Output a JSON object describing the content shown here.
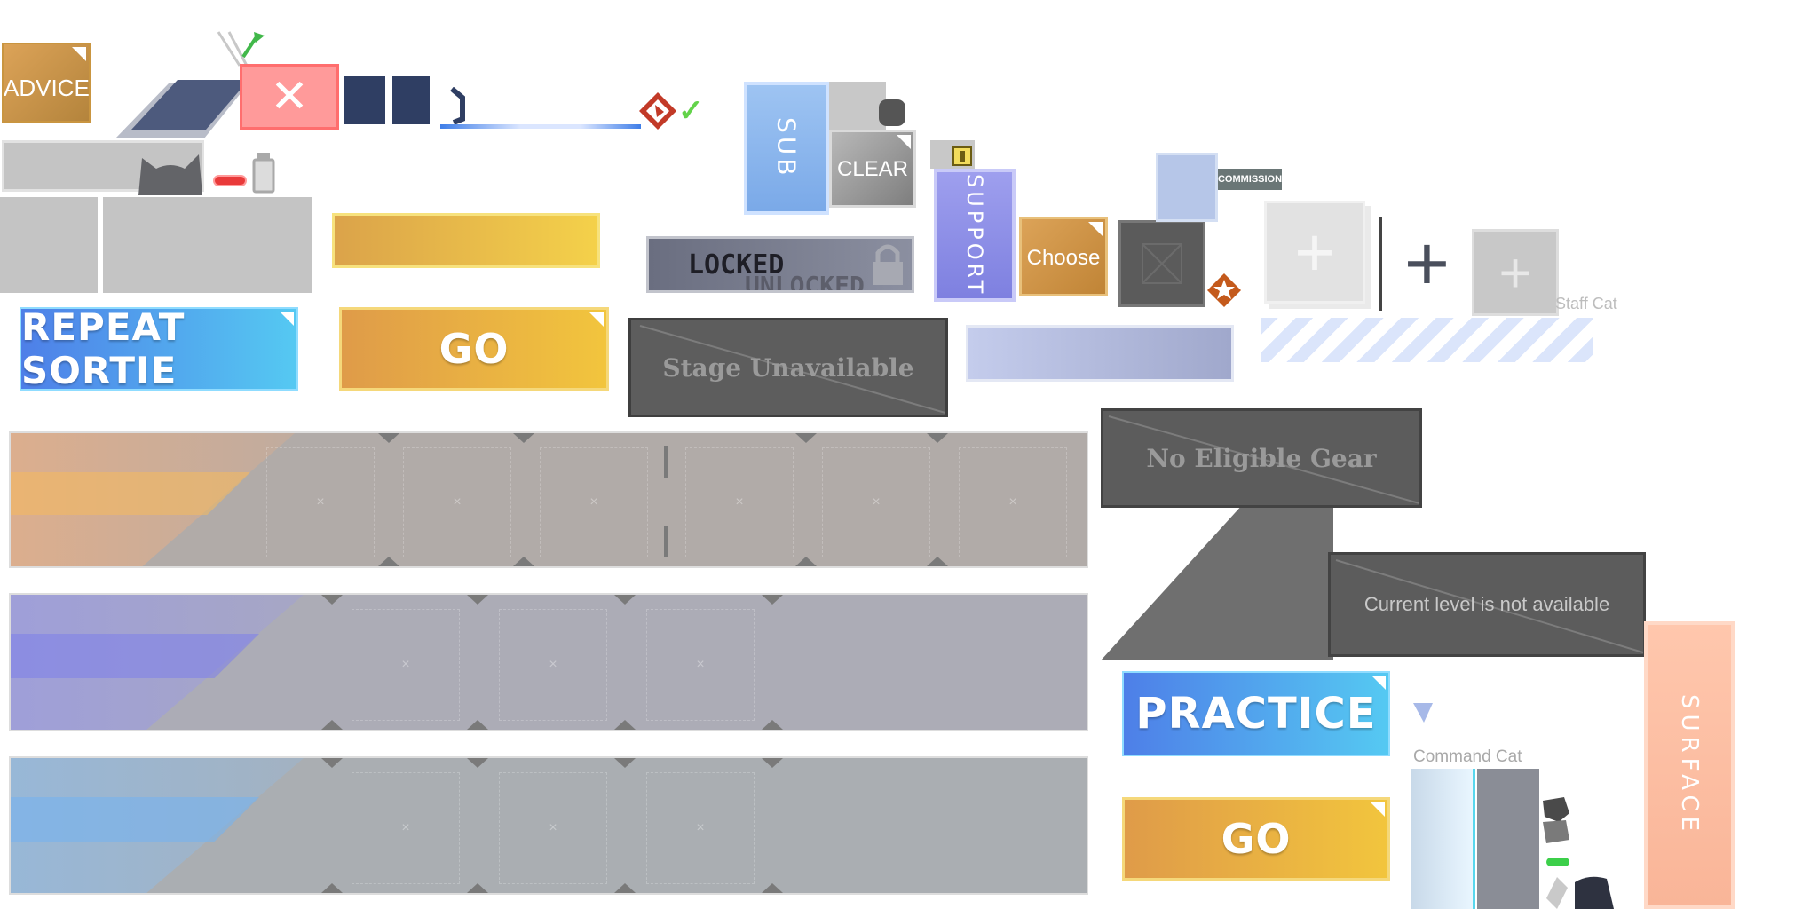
{
  "buttons": {
    "advice": "ADVICE",
    "sub": "SUB",
    "clear": "CLEAR",
    "support": "SUPPORT",
    "choose": "Choose",
    "commission": "COMMISSION",
    "locked": "LOCKED",
    "unlocked": "UNLOCKED",
    "repeat_sortie": "REPEAT SORTIE",
    "go": "GO",
    "practice": "PRACTICE",
    "go_bottom": "GO",
    "surface": "SURFACE"
  },
  "labels": {
    "stage_unavailable": "Stage Unavailable",
    "no_eligible_gear": "No Eligible Gear",
    "level_not_available": "Current level is not available",
    "staff_cat": "Staff Cat",
    "command_cat": "Command Cat"
  },
  "glyphs": {
    "close": "✕",
    "plus": "+",
    "slot": "×",
    "star": "★",
    "check": "✓"
  },
  "colors": {
    "orange": "#e3a440",
    "blue": "#4b86ee",
    "purple": "#8f90e8",
    "grey_panel": "#5c5c5c",
    "gold": "#f2c53d"
  },
  "icons": [
    "cat-silhouette-icon",
    "red-badge-icon",
    "checkmark-icon",
    "lock-icon",
    "clip-icon",
    "star-medal-icon",
    "plus-icon",
    "diamond-icon"
  ]
}
